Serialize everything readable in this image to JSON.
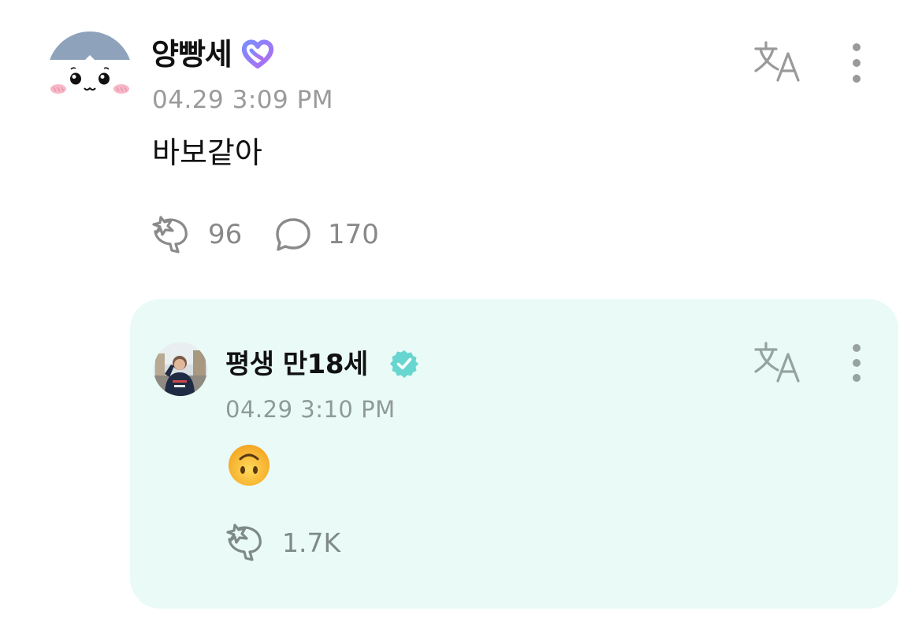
{
  "post": {
    "author": "양빵세",
    "author_badge_icon": "membership-heart-icon",
    "timestamp": "04.29 3:09 PM",
    "body": "바보같아",
    "like_count": "96",
    "comment_count": "170",
    "translate_icon": "translate-icon",
    "more_icon": "more-vertical-icon"
  },
  "reply": {
    "author": "평생 만18세",
    "author_badge_icon": "verified-check-icon",
    "timestamp": "04.29 3:10 PM",
    "body_emoji": "upside-down-face-emoji",
    "like_count": "1.7K",
    "translate_icon": "translate-icon",
    "more_icon": "more-vertical-icon"
  },
  "colors": {
    "reply_background": "#e9faf7",
    "verified_badge": "#67d6d0",
    "membership_badge_start": "#7b8cff",
    "membership_badge_end": "#b06cf0",
    "secondary_text": "#9a9a9a"
  }
}
